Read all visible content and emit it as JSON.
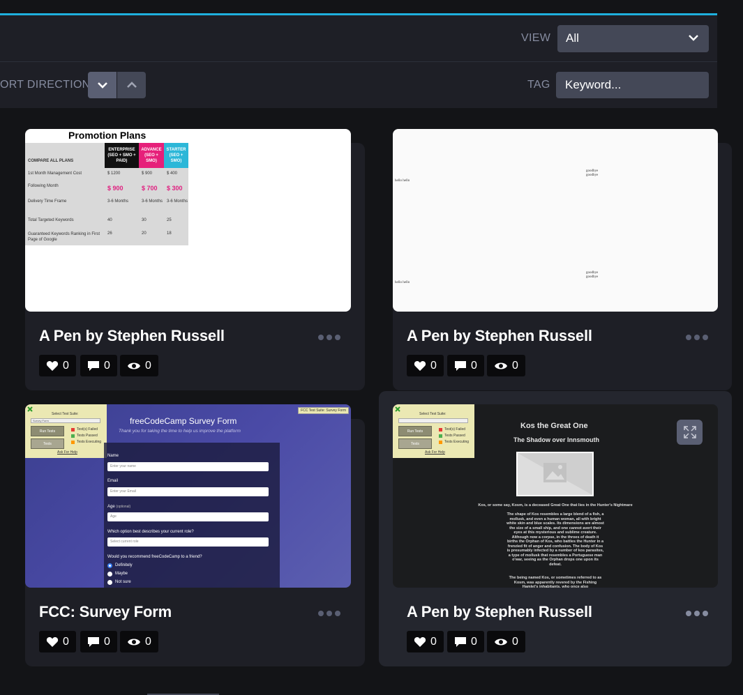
{
  "toolbar": {
    "view_label": "VIEW",
    "view_value": "All",
    "sort_direction_label": "ORT DIRECTION",
    "tag_label": "TAG",
    "tag_placeholder": "Keyword..."
  },
  "cards": [
    {
      "title": "A Pen by Stephen Russell",
      "likes": "0",
      "comments": "0",
      "views": "0",
      "preview": {
        "heading": "Promotion Plans",
        "compare_label": "COMPARE ALL PLANS",
        "plans": [
          "ENTERPRISE (SEO + SMO + PAID)",
          "ADVANCE (SEO + SMO)",
          "STARTER (SEO + SMO)"
        ],
        "rows": [
          {
            "label": "1st Month Management Cost",
            "values": [
              "$ 1200",
              "$ 900",
              "$ 400"
            ]
          },
          {
            "label": "Following Month",
            "values": [
              "$ 900",
              "$ 700",
              "$ 300"
            ]
          },
          {
            "label": "Delivery Time Frame",
            "values": [
              "3-6 Months",
              "3-6 Months",
              "3-6 Months"
            ]
          },
          {
            "label": "Total Targeted Keywords",
            "values": [
              "40",
              "30",
              "25"
            ]
          },
          {
            "label": "Guaranteed Keywords Ranking in First Page of Google",
            "values": [
              "26",
              "20",
              "18"
            ]
          }
        ]
      }
    },
    {
      "title": "A Pen by Stephen Russell",
      "likes": "0",
      "comments": "0",
      "views": "0",
      "preview": {
        "hello": "hello hello",
        "goodbye": "goodbye goodbye"
      }
    },
    {
      "title": "FCC: Survey Form",
      "likes": "0",
      "comments": "0",
      "views": "0",
      "preview": {
        "suite_label": "Select Test Suite:",
        "suite_value": "Survey Form",
        "run_tests": "Run Tests",
        "tests": "Tests",
        "legend": [
          "Test(s) Failed",
          "Tests Passed",
          "Tests Executing"
        ],
        "help": "Ask For Help",
        "badge": "FCC Test Suite: Survey Form",
        "heading": "freeCodeCamp Survey Form",
        "subheading": "Thank you for taking the time to help us improve the platform",
        "name_label": "Name",
        "name_placeholder": "Enter your name",
        "email_label": "Email",
        "email_placeholder": "Enter your Email",
        "age_label": "Age",
        "age_optional": "(optional)",
        "age_placeholder": "Age",
        "role_question": "Which option best describes your current role?",
        "role_placeholder": "Select current role",
        "recommend_question": "Would you recommend freeCodeCamp to a friend?",
        "options": [
          "Definitely",
          "Maybe",
          "Not sure"
        ]
      }
    },
    {
      "title": "A Pen by Stephen Russell",
      "likes": "0",
      "comments": "0",
      "views": "0",
      "preview": {
        "run_tests": "Run Tests",
        "tests": "Tests",
        "suite_label": "Select Test Suite:",
        "legend": [
          "Test(s) Failed",
          "Tests Passed",
          "Tests Executing"
        ],
        "help": "Ask For Help",
        "heading": "Kos the Great One",
        "subheading": "The Shadow over Innsmouth",
        "intro": "Kos, or some say, Kosm, is a deceased Great One that lies in the Hunter's Nightmare",
        "paragraph1": "The shape of Kos resembles a large blend of a fish, a mollusk, and even a human woman, all with bright white skin and blue scales. Its dimensions are almost the size of a small ship, and one cannot avert their eyes at this mysterious and sublime creature. Although now a corpse, in the throes of death it births the Orphan of Kos, who battles the Hunter in a frenzied fit of anger and confusion. The body of Kos is presumably infected by a number of kos parasites, a type of mollusk that resembles a Portuguese man o'war, seeing as the Orphan drops one upon its defeat.",
        "paragraph2": "The being named Kos, or sometimes referred to as Kosm, was apparently revered by the Fishing Hamlet's inhabitants, who once also"
      }
    }
  ],
  "colors": {
    "accent": "#1fb0de",
    "card": "#1e1f26",
    "page": "#131417",
    "control": "#444857"
  }
}
